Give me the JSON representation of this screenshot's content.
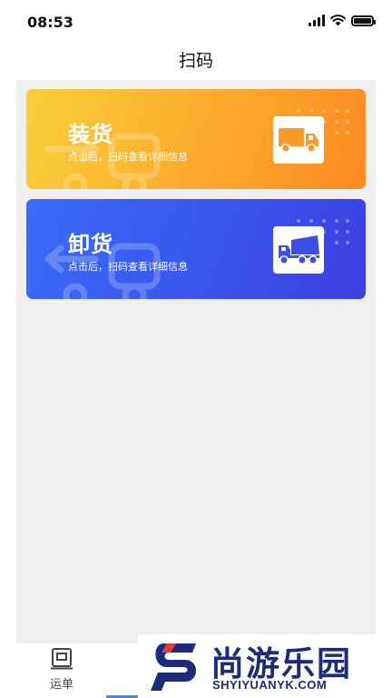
{
  "status_bar": {
    "time": "08:53"
  },
  "header": {
    "title": "扫码"
  },
  "cards": [
    {
      "title": "装货",
      "description": "点击后，扫码查看详细信息",
      "icon": "truck-icon"
    },
    {
      "title": "卸货",
      "description": "点击后，扫码查看详细信息",
      "icon": "dump-truck-icon"
    }
  ],
  "tab_bar": {
    "items": [
      {
        "label": "运单",
        "icon": "waybill-icon"
      }
    ]
  },
  "watermark": {
    "text": "尚游乐园",
    "subtext": "SHYIYUANYK.COM"
  },
  "colors": {
    "load_card_start": "#f8d03a",
    "load_card_end": "#fd8a22",
    "unload_card_start": "#3b6bf7",
    "unload_card_end": "#3d3fe0",
    "tab_active": "#3b8ff5",
    "watermark_navy": "#1d2b7a",
    "watermark_red": "#e43a3a"
  }
}
